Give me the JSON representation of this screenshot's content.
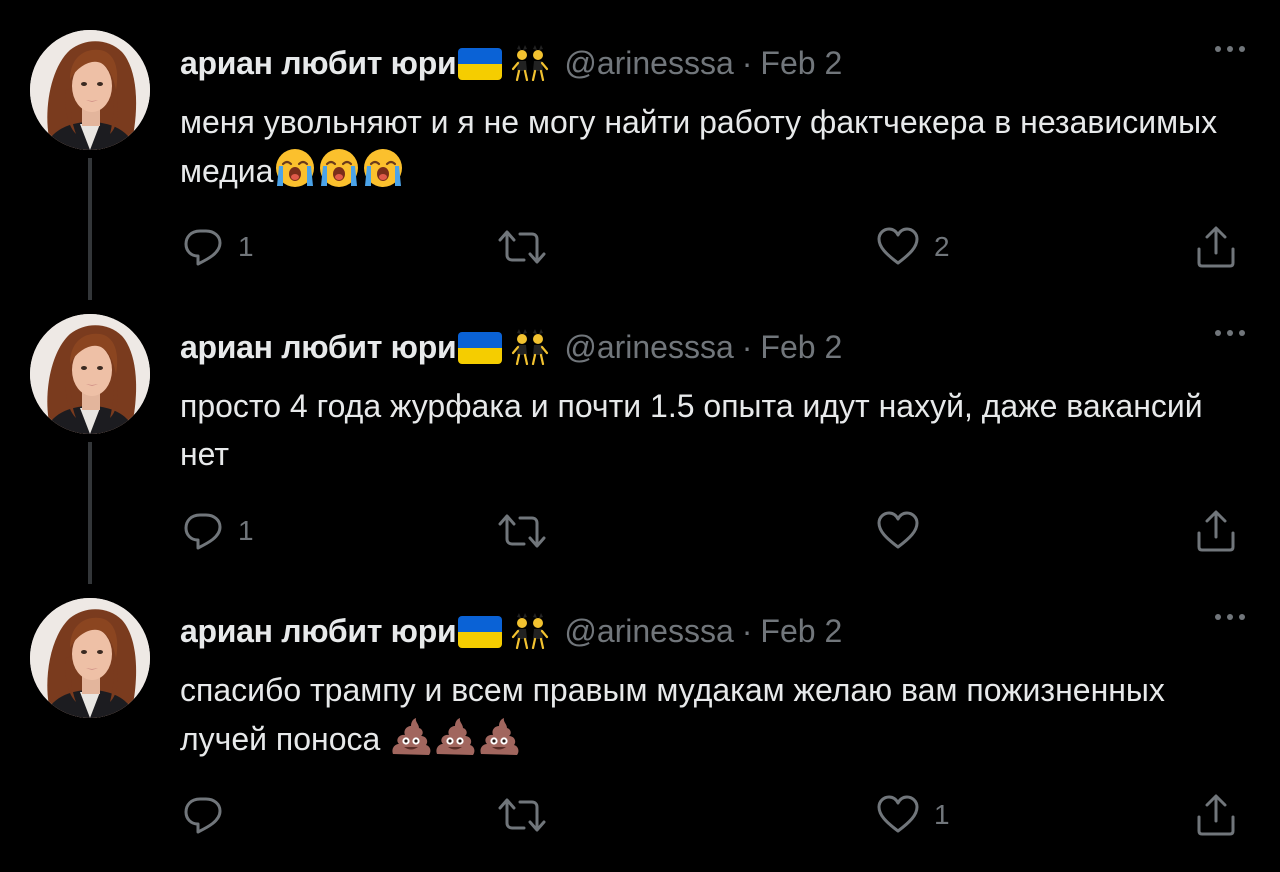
{
  "colors": {
    "background": "#000000",
    "text_primary": "#e7e9ea",
    "text_secondary": "#71767b",
    "thread_line": "#333639"
  },
  "tweets": [
    {
      "author": {
        "display_name": "ариан любит юри",
        "name_emojis": [
          "ukraine-flag",
          "dancing-women-with-bunny-ears-emoji"
        ],
        "handle": "@arinesssa",
        "separator": "·",
        "date": "Feb 2"
      },
      "text": "меня увольняют и я не могу найти работу фактчекера в независимых медиа",
      "text_emojis": [
        "loudly-crying-face",
        "loudly-crying-face",
        "loudly-crying-face"
      ],
      "stats": {
        "replies": "1",
        "retweets": "",
        "likes": "2"
      },
      "has_thread_line": true
    },
    {
      "author": {
        "display_name": "ариан любит юри",
        "name_emojis": [
          "ukraine-flag",
          "dancing-women-with-bunny-ears-emoji"
        ],
        "handle": "@arinesssa",
        "separator": "·",
        "date": "Feb 2"
      },
      "text": "просто 4 года журфака и почти 1.5 опыта идут нахуй, даже вакансий нет",
      "text_emojis": [],
      "stats": {
        "replies": "1",
        "retweets": "",
        "likes": ""
      },
      "has_thread_line": true
    },
    {
      "author": {
        "display_name": "ариан любит юри",
        "name_emojis": [
          "ukraine-flag",
          "dancing-women-with-bunny-ears-emoji"
        ],
        "handle": "@arinesssa",
        "separator": "·",
        "date": "Feb 2"
      },
      "text": "спасибо трампу и всем правым мудакам желаю вам пожизненных лучей поноса ",
      "text_emojis": [
        "pile-of-poo",
        "pile-of-poo",
        "pile-of-poo"
      ],
      "stats": {
        "replies": "",
        "retweets": "",
        "likes": "1"
      },
      "has_thread_line": false
    }
  ]
}
